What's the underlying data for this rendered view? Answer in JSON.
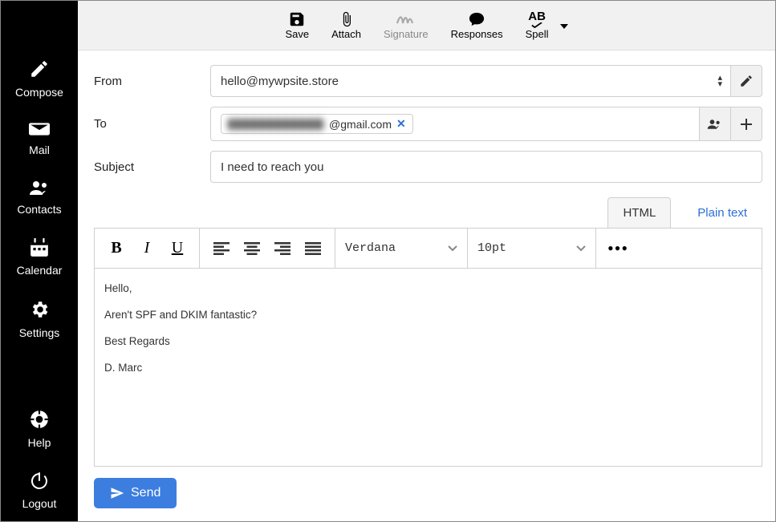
{
  "sidebar": {
    "items": [
      {
        "label": "Compose",
        "icon": "compose"
      },
      {
        "label": "Mail",
        "icon": "mail"
      },
      {
        "label": "Contacts",
        "icon": "contacts"
      },
      {
        "label": "Calendar",
        "icon": "calendar"
      },
      {
        "label": "Settings",
        "icon": "settings"
      }
    ],
    "bottom": [
      {
        "label": "Help",
        "icon": "help"
      },
      {
        "label": "Logout",
        "icon": "logout"
      }
    ]
  },
  "toolbar": {
    "save": "Save",
    "attach": "Attach",
    "signature": "Signature",
    "responses": "Responses",
    "spell": "Spell"
  },
  "compose": {
    "labels": {
      "from": "From",
      "to": "To",
      "subject": "Subject"
    },
    "from_value": "hello@mywpsite.store",
    "to_chip_suffix": "@gmail.com",
    "subject_value": "I need to reach you"
  },
  "tabs": {
    "html": "HTML",
    "plain": "Plain text",
    "active": "html"
  },
  "editor_toolbar": {
    "font_family": "Verdana",
    "font_size": "10pt"
  },
  "body_lines": [
    "Hello,",
    "Aren't SPF and DKIM fantastic?",
    "Best Regards",
    "D. Marc"
  ],
  "send_label": "Send"
}
